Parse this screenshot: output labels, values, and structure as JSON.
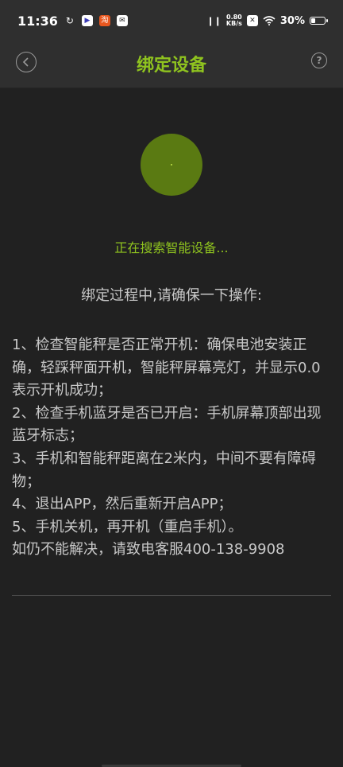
{
  "status": {
    "time": "11:36",
    "net_speed_value": "0.80",
    "net_speed_unit": "KB/s",
    "battery": "30%",
    "battery_level": 0.3
  },
  "header": {
    "title": "绑定设备",
    "help_symbol": "?"
  },
  "scan": {
    "status_text": "正在搜索智能设备..."
  },
  "instructions": {
    "heading": "绑定过程中,请确保一下操作:",
    "steps": [
      "1、检查智能秤是否正常开机：确保电池安装正确，轻踩秤面开机，智能秤屏幕亮灯，并显示0.0表示开机成功；",
      "2、检查手机蓝牙是否已开启：手机屏幕顶部出现蓝牙标志；",
      "3、手机和智能秤距离在2米内，中间不要有障碍物；",
      "4、退出APP，然后重新开启APP；",
      "5、手机关机，再开机（重启手机）。",
      "如仍不能解决，请致电客服400-138-9908"
    ]
  },
  "colors": {
    "accent": "#8fc31f",
    "background": "#212121",
    "header_bg": "#2f2f2f"
  }
}
